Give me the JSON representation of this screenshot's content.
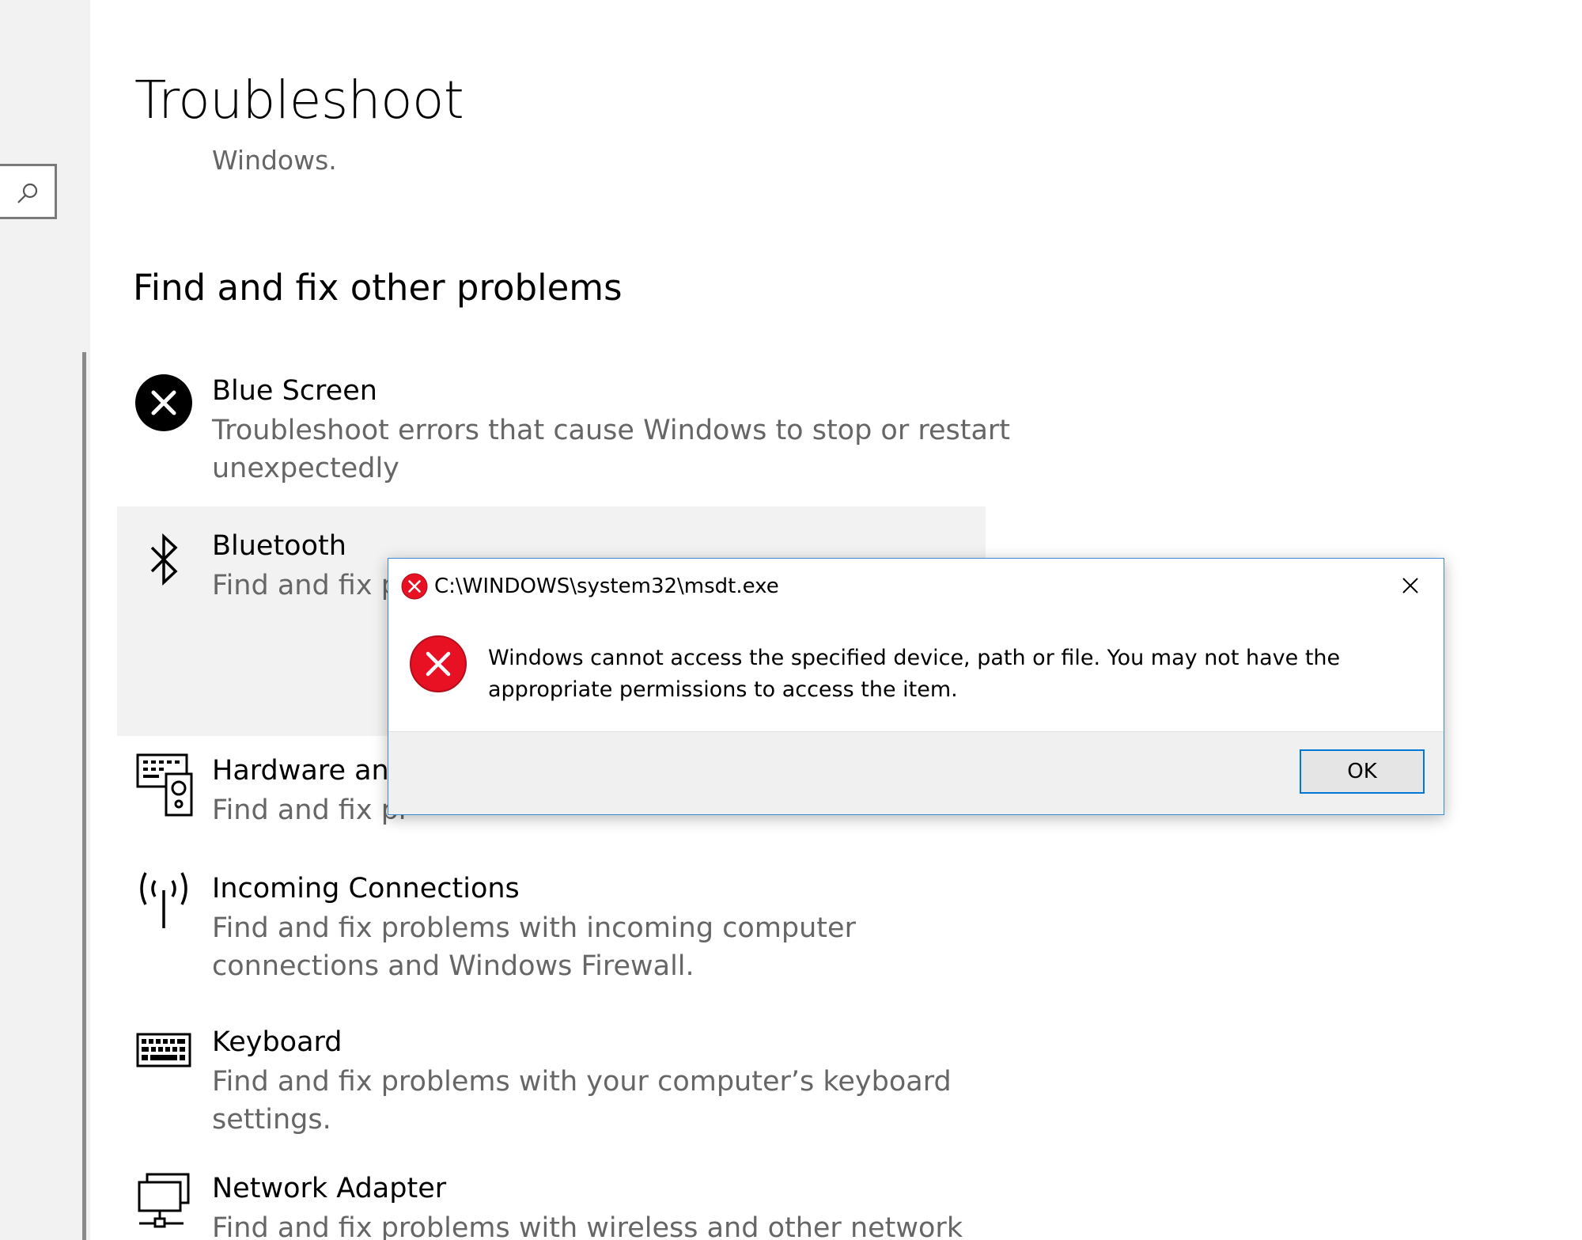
{
  "header": {
    "title": "Troubleshoot",
    "subtitle": "Windows."
  },
  "section": {
    "heading": "Find and fix other problems"
  },
  "items": [
    {
      "name": "Blue Screen",
      "desc": "Troubleshoot errors that cause Windows to stop or restart unexpectedly",
      "icon": "error-circle-icon"
    },
    {
      "name": "Bluetooth",
      "desc": "Find and fix pr",
      "icon": "bluetooth-icon"
    },
    {
      "name": "Hardware and",
      "desc": "Find and fix pr",
      "icon": "hardware-icon"
    },
    {
      "name": "Incoming Connections",
      "desc": "Find and fix problems with incoming computer connections and Windows Firewall.",
      "icon": "antenna-icon"
    },
    {
      "name": "Keyboard",
      "desc": "Find and fix problems with your computer’s keyboard settings.",
      "icon": "keyboard-icon"
    },
    {
      "name": "Network Adapter",
      "desc": "Find and fix problems with wireless and other network",
      "icon": "network-icon"
    }
  ],
  "dialog": {
    "title": "C:\\WINDOWS\\system32\\msdt.exe",
    "message": "Windows cannot access the specified device, path or file. You may not have the appropriate permissions to access the item.",
    "ok_label": "OK"
  },
  "colors": {
    "error_red": "#e81123",
    "dialog_border": "#3c8bd6",
    "accent": "#0078d7"
  }
}
